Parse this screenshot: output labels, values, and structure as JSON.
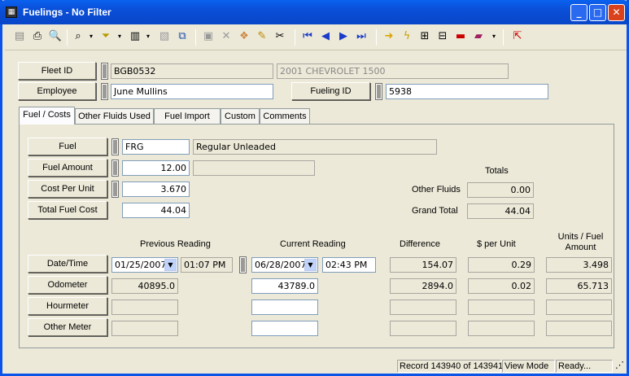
{
  "window": {
    "title": "Fuelings - No Filter",
    "icon": "app-icon"
  },
  "header": {
    "fleet_id_label": "Fleet ID",
    "fleet_id_value": "BGB0532",
    "vehicle_desc": "2001 CHEVROLET 1500",
    "employee_label": "Employee",
    "employee_value": "June Mullins",
    "fueling_id_label": "Fueling ID",
    "fueling_id_value": "5938"
  },
  "tabs": [
    {
      "label": "Fuel / Costs",
      "active": true
    },
    {
      "label": "Other Fluids Used"
    },
    {
      "label": "Fuel Import"
    },
    {
      "label": "Custom"
    },
    {
      "label": "Comments"
    }
  ],
  "fuel": {
    "fuel_label": "Fuel",
    "fuel_code": "FRG",
    "fuel_desc": "Regular Unleaded",
    "amount_label": "Fuel Amount",
    "amount_value": "12.00",
    "cpu_label": "Cost Per Unit",
    "cpu_value": "3.670",
    "total_label": "Total Fuel Cost",
    "total_value": "44.04"
  },
  "totals": {
    "heading": "Totals",
    "other_fluids_label": "Other Fluids",
    "other_fluids_value": "0.00",
    "grand_total_label": "Grand Total",
    "grand_total_value": "44.04"
  },
  "readings": {
    "col_previous": "Previous Reading",
    "col_current": "Current Reading",
    "col_difference": "Difference",
    "col_per_unit": "$ per Unit",
    "col_units_fuel": "Units / Fuel Amount",
    "datetime_label": "Date/Time",
    "prev_date": "01/25/2007",
    "prev_time": "01:07 PM",
    "cur_date": "06/28/2007",
    "cur_time": "02:43 PM",
    "dt_difference": "154.07",
    "dt_per_unit": "0.29",
    "dt_units_fuel": "3.498",
    "odometer_label": "Odometer",
    "odo_prev": "40895.0",
    "odo_cur": "43789.0",
    "odo_difference": "2894.0",
    "odo_per_unit": "0.02",
    "odo_units_fuel": "65.713",
    "hourmeter_label": "Hourmeter",
    "other_meter_label": "Other Meter"
  },
  "status": {
    "record": "Record 143940 of 143941",
    "mode": "View Mode",
    "state": "Ready..."
  }
}
